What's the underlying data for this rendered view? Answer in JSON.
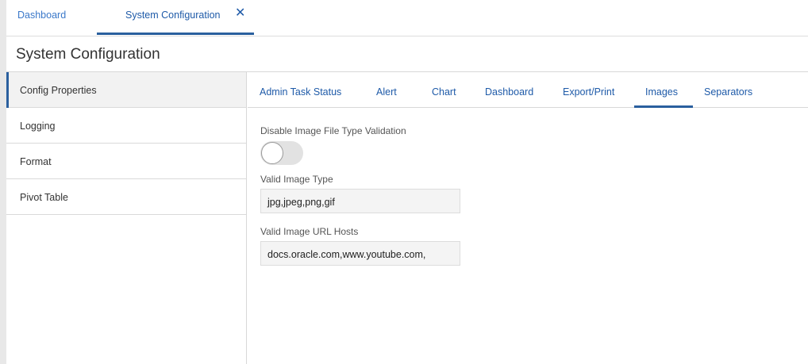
{
  "top_tabs": {
    "dashboard_label": "Dashboard",
    "system_config_label": "System Configuration",
    "close_glyph": "✕"
  },
  "page": {
    "title": "System Configuration"
  },
  "sidebar": {
    "items": [
      {
        "label": "Config Properties",
        "active": true
      },
      {
        "label": "Logging",
        "active": false
      },
      {
        "label": "Format",
        "active": false
      },
      {
        "label": "Pivot Table",
        "active": false
      }
    ]
  },
  "sub_tabs": {
    "items": [
      {
        "label": "Admin Task Status"
      },
      {
        "label": "Alert"
      },
      {
        "label": "Chart"
      },
      {
        "label": "Dashboard"
      },
      {
        "label": "Export/Print"
      },
      {
        "label": "Images"
      },
      {
        "label": "Separators"
      }
    ],
    "active": "Images"
  },
  "form": {
    "disable_validation_label": "Disable Image File Type Validation",
    "disable_validation_on": false,
    "valid_image_type_label": "Valid Image Type",
    "valid_image_type_value": "jpg,jpeg,png,gif",
    "valid_url_hosts_label": "Valid Image URL Hosts",
    "valid_url_hosts_value": "docs.oracle.com,www.youtube.com,"
  },
  "colors": {
    "accent": "#2a5f9e",
    "link": "#1e5aa8"
  },
  "icons": {
    "close": "close-icon"
  }
}
